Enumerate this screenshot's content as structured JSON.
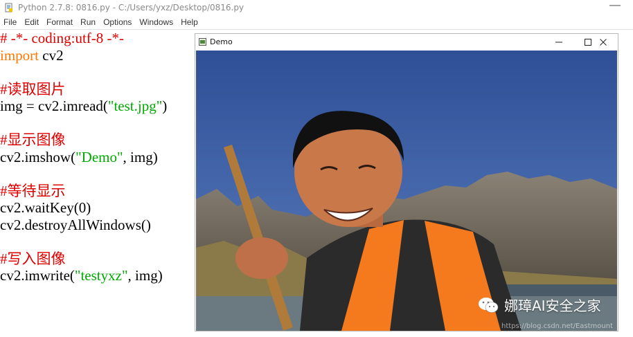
{
  "idle": {
    "title": "Python 2.7.8: 0816.py - C:/Users/yxz/Desktop/0816.py",
    "minimize_glyph": "—",
    "menu": [
      "File",
      "Edit",
      "Format",
      "Run",
      "Options",
      "Windows",
      "Help"
    ],
    "code": {
      "l1": "# -*- coding:utf-8 -*-",
      "l2_kw": "import",
      "l2_rest": " cv2",
      "l4": "#读取图片",
      "l5_a": "img = cv2.imread(",
      "l5_str": "\"test.jpg\"",
      "l5_b": ")",
      "l7": "#显示图像",
      "l8_a": "cv2.imshow(",
      "l8_str": "\"Demo\"",
      "l8_b": ", img)",
      "l10": "#等待显示",
      "l11": "cv2.waitKey(0)",
      "l12": "cv2.destroyAllWindows()",
      "l14": "#写入图像",
      "l15_a": "cv2.imwrite(",
      "l15_str": "\"testyxz\"",
      "l15_b": ", img)"
    }
  },
  "demo_window": {
    "title": "Demo",
    "colors": {
      "sky": "#355aa1",
      "vest": "#f57a1e",
      "mountain": "#6e6558"
    }
  },
  "watermark": {
    "label": "娜璋AI安全之家",
    "icon": "wechat-icon",
    "url_text": "https://blog.csdn.net/Eastmount"
  }
}
